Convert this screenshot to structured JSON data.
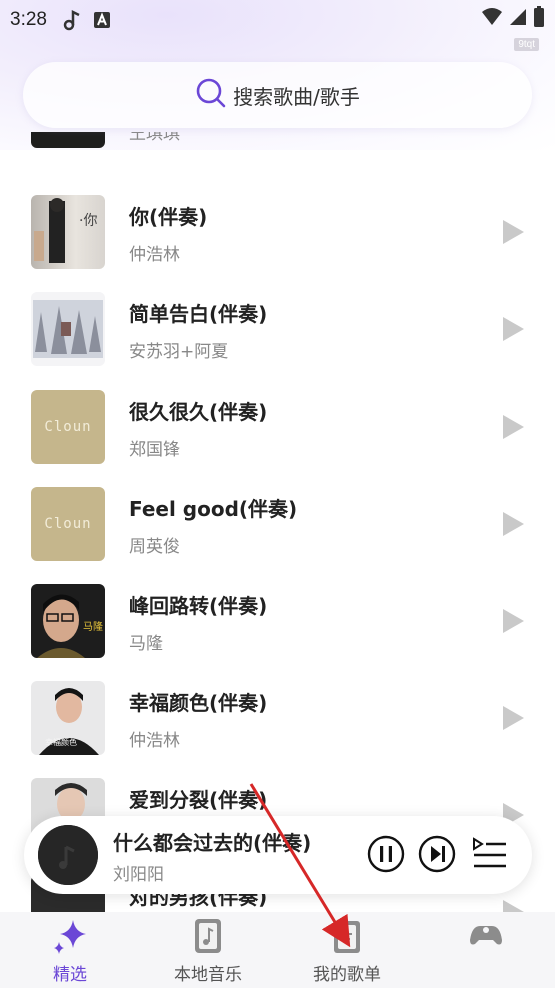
{
  "status_bar": {
    "time": "3:28",
    "watermark": "9tqt",
    "icons": [
      "music-note-icon",
      "font-a-icon",
      "wifi-icon",
      "signal-icon",
      "battery-icon"
    ]
  },
  "search": {
    "placeholder": "搜索歌曲/歌手"
  },
  "songs": [
    {
      "title": "",
      "artist": "王琪琪"
    },
    {
      "title": "你(伴奏)",
      "artist": "仲浩林"
    },
    {
      "title": "简单告白(伴奏)",
      "artist": "安苏羽+阿夏"
    },
    {
      "title": "很久很久(伴奏)",
      "artist": "郑国锋"
    },
    {
      "title": "Feel good(伴奏)",
      "artist": "周英俊"
    },
    {
      "title": "峰回路转(伴奏)",
      "artist": "马隆"
    },
    {
      "title": "幸福颜色(伴奏)",
      "artist": "仲浩林"
    },
    {
      "title": "爱到分裂(伴奏)",
      "artist": ""
    },
    {
      "title": "对的男孩(伴奏)",
      "artist": ""
    }
  ],
  "cover_texts": {
    "clown": "Cloun",
    "malong": "马隆",
    "xingfu": "幸福颜色"
  },
  "mini_player": {
    "title": "什么都会过去的(伴奏)",
    "artist": "刘阳阳"
  },
  "nav": {
    "items": [
      {
        "label": "精选",
        "icon": "sparkle-icon",
        "active": true
      },
      {
        "label": "本地音乐",
        "icon": "local-music-icon",
        "active": false
      },
      {
        "label": "我的歌单",
        "icon": "playlist-icon",
        "active": false
      },
      {
        "label": "",
        "icon": "gamepad-icon",
        "active": false
      }
    ]
  },
  "colors": {
    "accent": "#6b47d6",
    "annotation_arrow": "#d62828"
  }
}
